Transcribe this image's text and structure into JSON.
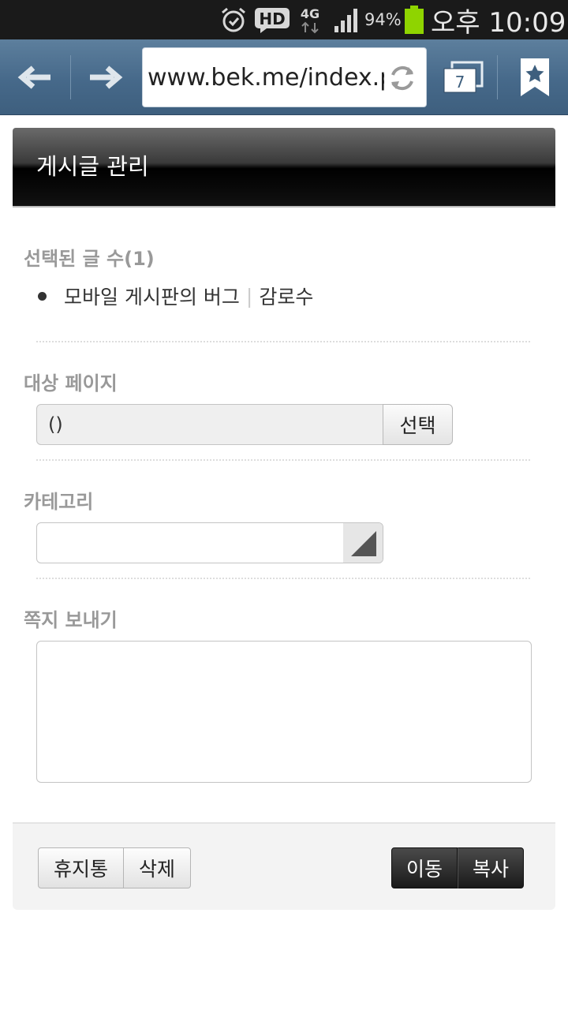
{
  "status_bar": {
    "battery_percent": "94%",
    "time": "오후 10:09",
    "network": "4G",
    "hd_label": "HD",
    "icons": [
      "alarm-icon",
      "hd-icon",
      "4g-icon",
      "signal-icon",
      "battery-icon"
    ],
    "battery_color": "#8fd400"
  },
  "browser": {
    "url": "www.bek.me/index.p",
    "tab_count": "7",
    "icons": [
      "back-arrow-icon",
      "forward-arrow-icon",
      "reload-icon",
      "tabs-icon",
      "bookmark-star-icon"
    ]
  },
  "page": {
    "title": "게시글 관리",
    "selected": {
      "label": "선택된 글 수(1)",
      "items": [
        {
          "title": "모바일 게시판의 버그",
          "author": "감로수"
        }
      ]
    },
    "target_page": {
      "label": "대상 페이지",
      "value": "()",
      "select_button": "선택"
    },
    "category": {
      "label": "카테고리",
      "value": ""
    },
    "message": {
      "label": "쪽지 보내기",
      "value": ""
    },
    "footer": {
      "trash_button": "휴지통",
      "delete_button": "삭제",
      "move_button": "이동",
      "copy_button": "복사"
    }
  }
}
